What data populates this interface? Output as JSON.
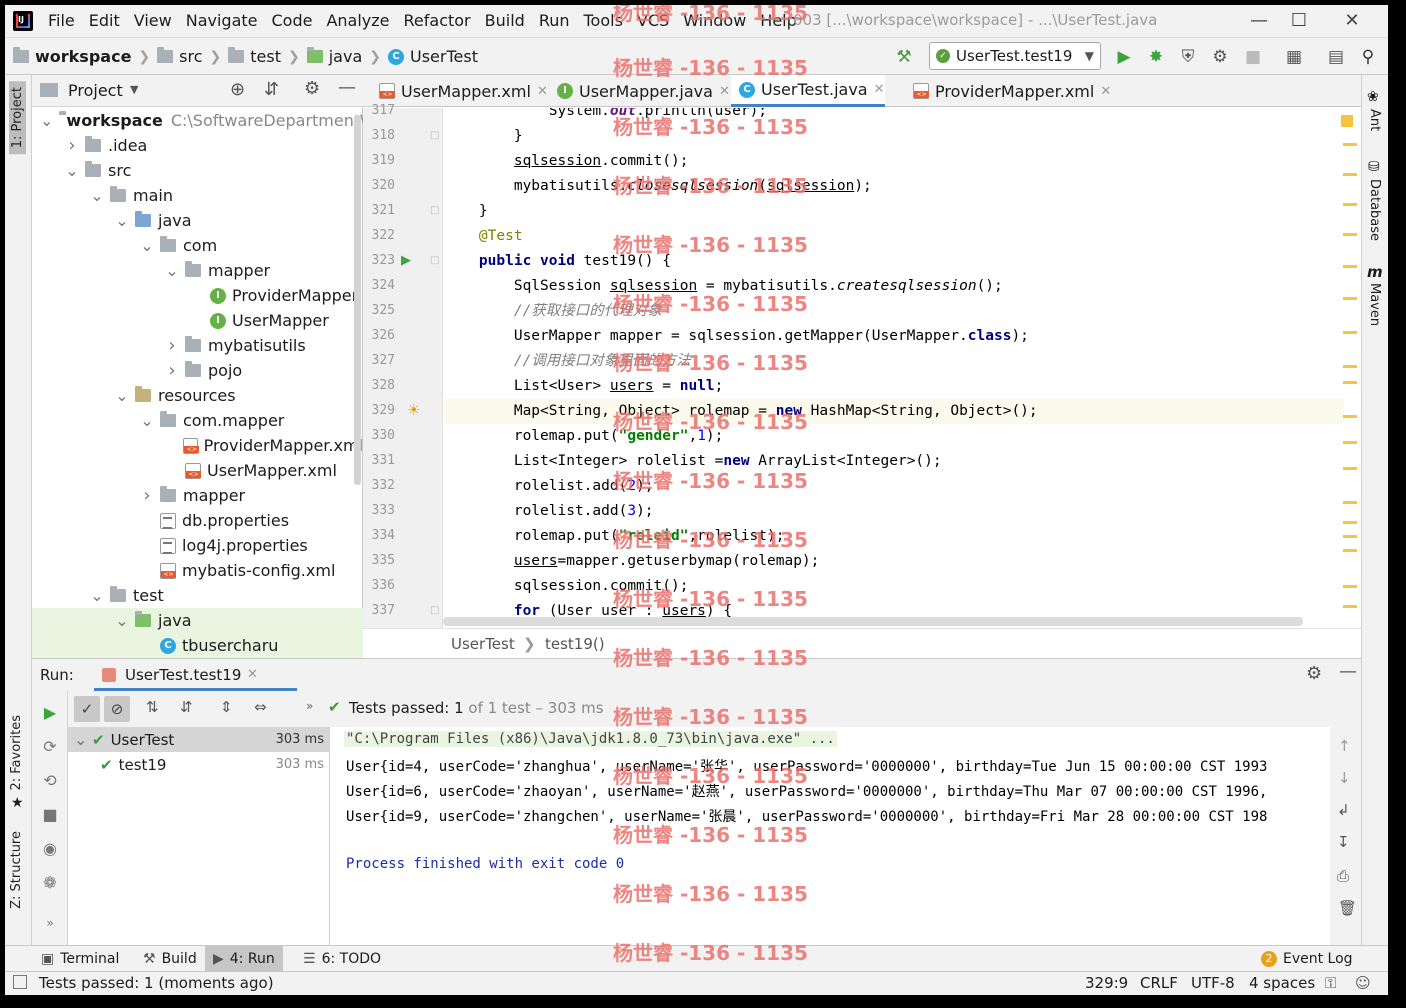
{
  "menubar": {
    "items": [
      "File",
      "Edit",
      "View",
      "Navigate",
      "Code",
      "Analyze",
      "Refactor",
      "Build",
      "Run",
      "Tools",
      "VCS",
      "Window",
      "Help"
    ],
    "title": "003 [...\\workspace\\workspace] - ...\\UserTest.java"
  },
  "navbar": {
    "crumbs": [
      "workspace",
      "src",
      "test",
      "java",
      "UserTest"
    ],
    "run_config": "UserTest.test19"
  },
  "tool_strips": {
    "left": [
      "1: Project",
      "2: Favorites",
      "Z: Structure"
    ],
    "right": [
      "Ant",
      "Database",
      "Maven"
    ]
  },
  "project": {
    "title": "Project",
    "tree": [
      {
        "label": "workspace",
        "extra": "C:\\SoftwareDepartment\\w",
        "depth": 0,
        "arrow": "open",
        "icon": "folder",
        "bold": true
      },
      {
        "label": ".idea",
        "depth": 1,
        "arrow": "closed",
        "icon": "folder"
      },
      {
        "label": "src",
        "depth": 1,
        "arrow": "open",
        "icon": "folder"
      },
      {
        "label": "main",
        "depth": 2,
        "arrow": "open",
        "icon": "folder"
      },
      {
        "label": "java",
        "depth": 3,
        "arrow": "open",
        "icon": "folder-blue"
      },
      {
        "label": "com",
        "depth": 4,
        "arrow": "open",
        "icon": "folder"
      },
      {
        "label": "mapper",
        "depth": 5,
        "arrow": "open",
        "icon": "folder"
      },
      {
        "label": "ProviderMapper",
        "depth": 6,
        "arrow": "none",
        "icon": "iface"
      },
      {
        "label": "UserMapper",
        "depth": 6,
        "arrow": "none",
        "icon": "iface"
      },
      {
        "label": "mybatisutils",
        "depth": 5,
        "arrow": "closed",
        "icon": "folder"
      },
      {
        "label": "pojo",
        "depth": 5,
        "arrow": "closed",
        "icon": "folder"
      },
      {
        "label": "resources",
        "depth": 3,
        "arrow": "open",
        "icon": "folder-res"
      },
      {
        "label": "com.mapper",
        "depth": 4,
        "arrow": "open",
        "icon": "folder"
      },
      {
        "label": "ProviderMapper.xml",
        "depth": 5,
        "arrow": "none",
        "icon": "xml"
      },
      {
        "label": "UserMapper.xml",
        "depth": 5,
        "arrow": "none",
        "icon": "xml"
      },
      {
        "label": "mapper",
        "depth": 4,
        "arrow": "closed",
        "icon": "folder"
      },
      {
        "label": "db.properties",
        "depth": 4,
        "arrow": "none",
        "icon": "prop"
      },
      {
        "label": "log4j.properties",
        "depth": 4,
        "arrow": "none",
        "icon": "prop"
      },
      {
        "label": "mybatis-config.xml",
        "depth": 4,
        "arrow": "none",
        "icon": "xml"
      },
      {
        "label": "test",
        "depth": 2,
        "arrow": "open",
        "icon": "folder"
      },
      {
        "label": "java",
        "depth": 3,
        "arrow": "open",
        "icon": "folder-green",
        "highlight": true
      },
      {
        "label": "tbusercharu",
        "depth": 4,
        "arrow": "none",
        "icon": "cls",
        "highlight": true
      }
    ]
  },
  "editor": {
    "tabs": [
      {
        "label": "UserMapper.xml",
        "icon": "xml",
        "active": false
      },
      {
        "label": "UserMapper.java",
        "icon": "iface",
        "active": false
      },
      {
        "label": "UserTest.java",
        "icon": "cls",
        "active": true
      },
      {
        "label": "ProviderMapper.xml",
        "icon": "xml",
        "active": false
      }
    ],
    "current_line": "329",
    "lines": [
      {
        "n": "317",
        "html": "            System.<span class=\"field\">out</span>.println(user);"
      },
      {
        "n": "318",
        "html": "        }"
      },
      {
        "n": "319",
        "html": "        <span class=\"ul\">sqlsession</span>.commit();"
      },
      {
        "n": "320",
        "html": "        mybatisutils.<span class=\"it\">closesqlsession</span>(<span class=\"ul\">sqlsession</span>);"
      },
      {
        "n": "321",
        "html": "    }"
      },
      {
        "n": "322",
        "html": "    <span class=\"ann\">@Test</span>"
      },
      {
        "n": "323",
        "html": "    <span class=\"kw\">public void</span> test19() {"
      },
      {
        "n": "324",
        "html": "        SqlSession <span class=\"ul\">sqlsession</span> = mybatisutils.<span class=\"it\">createsqlsession</span>();"
      },
      {
        "n": "325",
        "html": "        <span class=\"cm\">//获取接口的代理对象</span>"
      },
      {
        "n": "326",
        "html": "        UserMapper mapper = sqlsession.getMapper(UserMapper.<span class=\"kw\">class</span>);"
      },
      {
        "n": "327",
        "html": "        <span class=\"cm\">//调用接口对象里面的方法</span>"
      },
      {
        "n": "328",
        "html": "        List&lt;User&gt; <span class=\"ul\">users</span> = <span class=\"kw\">null</span>;"
      },
      {
        "n": "329",
        "html": "        Map&lt;String, Object&gt; rolemap = <span class=\"kw\">new</span> HashMap&lt;String, Object&gt;();"
      },
      {
        "n": "330",
        "html": "        rolemap.put(<span class=\"str\">\"gender\"</span>,<span class=\"num\">1</span>);"
      },
      {
        "n": "331",
        "html": "        List&lt;Integer&gt; rolelist =<span class=\"kw\">new</span> ArrayList&lt;Integer&gt;();"
      },
      {
        "n": "332",
        "html": "        rolelist.add(<span class=\"num\">2</span>);"
      },
      {
        "n": "333",
        "html": "        rolelist.add(<span class=\"num\">3</span>);"
      },
      {
        "n": "334",
        "html": "        rolemap.put(<span class=\"str\">\"roleid\"</span>,rolelist);"
      },
      {
        "n": "335",
        "html": "        <span class=\"ul\">users</span>=mapper.getuserbymap(rolemap);"
      },
      {
        "n": "336",
        "html": "        sqlsession.commit();"
      },
      {
        "n": "337",
        "html": "        <span class=\"kw\">for</span> (User user : <span class=\"ul\">users</span>) {"
      }
    ],
    "breadcrumb": [
      "UserTest",
      "test19()"
    ]
  },
  "run": {
    "label": "Run:",
    "tab": "UserTest.test19",
    "status_prefix": "Tests passed:",
    "status_count": "1",
    "status_suffix": "of 1 test – 303 ms",
    "tests": [
      {
        "name": "UserTest",
        "time": "303 ms",
        "depth": 0
      },
      {
        "name": "test19",
        "time": "303 ms",
        "depth": 1
      }
    ],
    "console": [
      "\"C:\\Program Files (x86)\\Java\\jdk1.8.0_73\\bin\\java.exe\" ...",
      "User{id=4, userCode='zhanghua', userName='张华', userPassword='0000000', birthday=Tue Jun 15 00:00:00 CST 1993",
      "User{id=6, userCode='zhaoyan', userName='赵燕', userPassword='0000000', birthday=Thu Mar 07 00:00:00 CST 1996,",
      "User{id=9, userCode='zhangchen', userName='张晨', userPassword='0000000', birthday=Fri Mar 28 00:00:00 CST 198",
      "",
      "Process finished with exit code 0"
    ]
  },
  "bottom_tabs": [
    {
      "label": "Terminal",
      "icon": "terminal-icon"
    },
    {
      "label": "Build",
      "icon": "hammer-icon"
    },
    {
      "label": "4: Run",
      "icon": "run-icon",
      "selected": true
    },
    {
      "label": "6: TODO",
      "icon": "todo-icon"
    }
  ],
  "event_log": {
    "count": "2",
    "label": "Event Log"
  },
  "statusbar": {
    "message": "Tests passed: 1 (moments ago)",
    "position": "329:9",
    "line_sep": "CRLF",
    "encoding": "UTF-8",
    "indent": "4 spaces"
  },
  "watermark": "杨世睿 -136 - 1135"
}
